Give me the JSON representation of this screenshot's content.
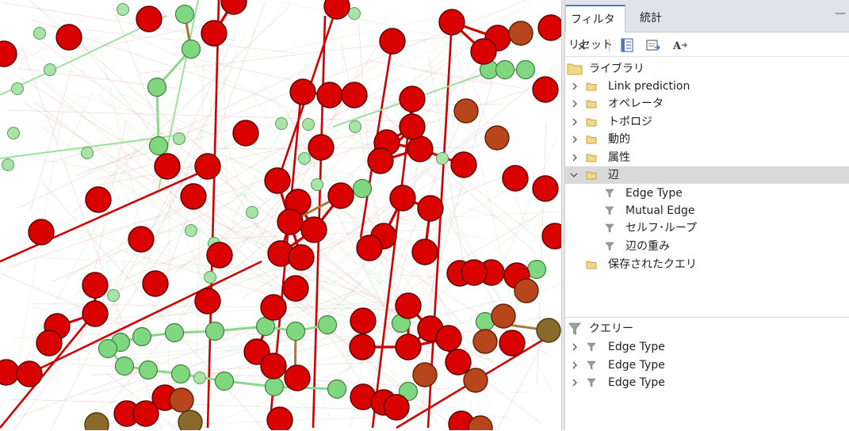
{
  "panel": {
    "tabs": [
      {
        "label": "フィルタ",
        "active": true,
        "close_label": "✕"
      },
      {
        "label": "統計",
        "active": false
      }
    ],
    "minimize_label": "—",
    "toolbar": {
      "reset_label": "リセット",
      "icons": [
        "filter-tree-icon",
        "export-icon",
        "font-settings-icon"
      ]
    },
    "library": {
      "label": "ライブラリ",
      "categories": [
        {
          "label": "Link prediction",
          "expanded": false
        },
        {
          "label": "オペレータ",
          "expanded": false
        },
        {
          "label": "トポロジ",
          "expanded": false
        },
        {
          "label": "動的",
          "expanded": false
        },
        {
          "label": "属性",
          "expanded": false
        },
        {
          "label": "辺",
          "expanded": true,
          "selected": true,
          "children": [
            "Edge Type",
            "Mutual Edge",
            "セルフ･ループ",
            "辺の重み"
          ]
        }
      ],
      "saved_queries": "保存されたクエリ"
    },
    "queries": {
      "label": "クエリー",
      "items": [
        "Edge Type",
        "Edge Type",
        "Edge Type"
      ]
    }
  },
  "graph": {
    "colors": {
      "red_node": "#d90000",
      "red_edge": "#cc0000",
      "green_node": "#7fd87f",
      "light_green_node": "#a8e4a8",
      "brown_node": "#b8461c",
      "olive_node": "#8a6a2a",
      "background": "#ffffff"
    }
  }
}
